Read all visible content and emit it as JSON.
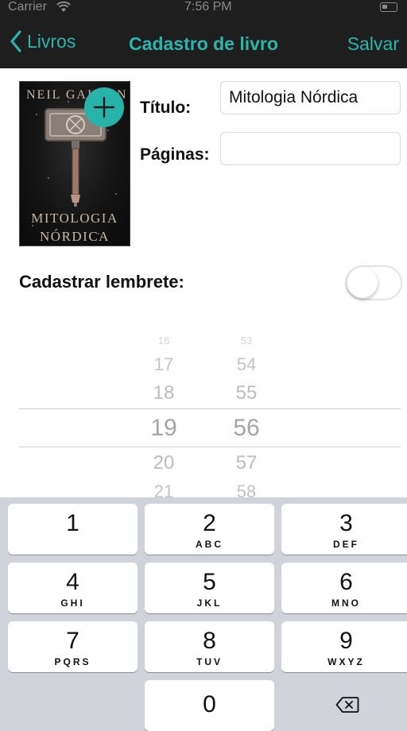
{
  "status_bar": {
    "carrier": "Carrier",
    "time": "7:56 PM"
  },
  "nav": {
    "back_label": "Livros",
    "title": "Cadastro de livro",
    "save_label": "Salvar"
  },
  "cover": {
    "author": "NEIL GAIMAN",
    "title_line1": "MITOLOGIA",
    "title_line2": "NÓRDICA"
  },
  "form": {
    "title_label": "Título:",
    "title_value": "Mitologia Nórdica",
    "pages_label": "Páginas:",
    "pages_value": ""
  },
  "reminder": {
    "label": "Cadastrar lembrete:",
    "enabled": false
  },
  "picker": {
    "hours": [
      "16",
      "17",
      "18",
      "19",
      "20",
      "21"
    ],
    "minutes": [
      "53",
      "54",
      "55",
      "56",
      "57",
      "58"
    ],
    "selected_hour": "19",
    "selected_minute": "56"
  },
  "keypad": {
    "keys": [
      {
        "digit": "1",
        "letters": ""
      },
      {
        "digit": "2",
        "letters": "ABC"
      },
      {
        "digit": "3",
        "letters": "DEF"
      },
      {
        "digit": "4",
        "letters": "GHI"
      },
      {
        "digit": "5",
        "letters": "JKL"
      },
      {
        "digit": "6",
        "letters": "MNO"
      },
      {
        "digit": "7",
        "letters": "PQRS"
      },
      {
        "digit": "8",
        "letters": "TUV"
      },
      {
        "digit": "9",
        "letters": "WXYZ"
      },
      {
        "digit": "0",
        "letters": ""
      }
    ]
  },
  "colors": {
    "accent": "#2bb5ac",
    "nav_background": "#1e1e1e",
    "keypad_background": "#d0d3d9"
  }
}
